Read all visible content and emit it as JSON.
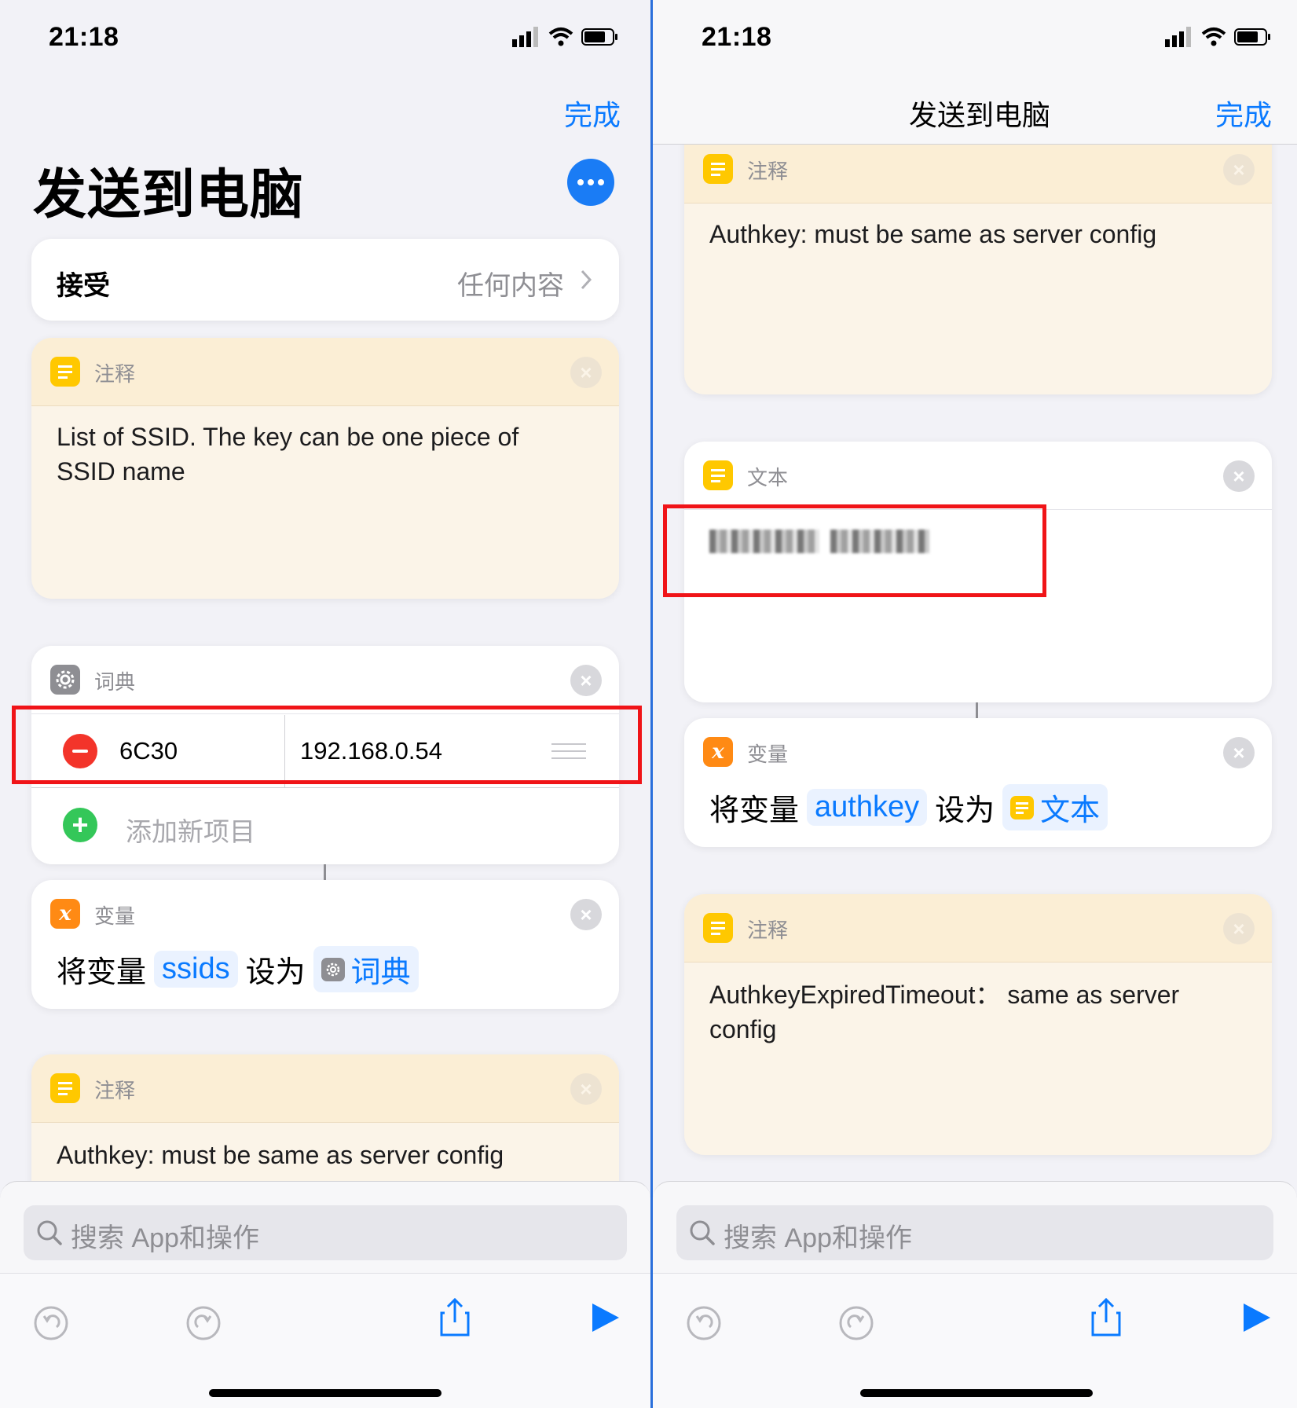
{
  "status": {
    "time": "21:18"
  },
  "left": {
    "done_label": "完成",
    "title": "发送到电脑",
    "more_icon": "ellipsis-icon",
    "accept": {
      "label": "接受",
      "value": "任何内容"
    },
    "comment1": {
      "header": "注释",
      "text_line1": "List of SSID. The key can be one piece of",
      "text_line2": "SSID name"
    },
    "dictionary": {
      "header": "词典",
      "key": "6C30",
      "value": "192.168.0.54",
      "add_label": "添加新项目"
    },
    "variable": {
      "header": "变量",
      "prefix": "将变量",
      "name": "ssids",
      "mid": "设为",
      "value": "词典"
    },
    "comment2": {
      "header": "注释",
      "text": "Authkey: must be same as server config"
    }
  },
  "right": {
    "title": "发送到电脑",
    "done_label": "完成",
    "comment1": {
      "header": "注释",
      "text": "Authkey: must be same as server config"
    },
    "text_action": {
      "header": "文本"
    },
    "variable": {
      "header": "变量",
      "prefix": "将变量",
      "name": "authkey",
      "mid": "设为",
      "value": "文本"
    },
    "comment2": {
      "header": "注释",
      "text_line1": "AuthkeyExpiredTimeout： same as server",
      "text_line2": "config"
    }
  },
  "search": {
    "placeholder": "搜索 App和操作"
  },
  "colors": {
    "accent": "#0a7aff",
    "highlight": "#f01418",
    "note": "#ffc800",
    "variable": "#ff8a14"
  }
}
